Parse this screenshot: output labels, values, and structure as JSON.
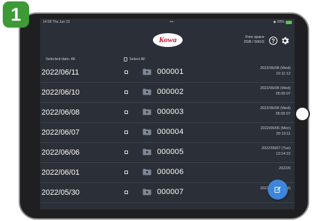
{
  "step_number": "1",
  "status_bar": {
    "time": "14:59  Thu Jun 23",
    "center": "•••",
    "battery": "83%"
  },
  "header": {
    "logo_text": "Kowa",
    "free_space_label": "Free space",
    "free_space_value": "2GB / 59GS"
  },
  "subheader": {
    "selected_date": "Selected date: All",
    "select_all": "Select All"
  },
  "rows": [
    {
      "date": "2022/06/11",
      "name": "000001",
      "mod_date": "2022/06/08 (Wed)",
      "mod_time": "10:11:12"
    },
    {
      "date": "2022/06/10",
      "name": "000002",
      "mod_date": "2022/06/08 (Wed)",
      "mod_time": "05:06:07"
    },
    {
      "date": "2022/06/08",
      "name": "000003",
      "mod_date": "2022/06/08 (Wed)",
      "mod_time": "05:06:07"
    },
    {
      "date": "2022/06/07",
      "name": "000004",
      "mod_date": "2022/06/06 (Mon)",
      "mod_time": "20:19:11"
    },
    {
      "date": "2022/06/06",
      "name": "000005",
      "mod_date": "2022/06/07 (Tue)",
      "mod_time": "13:14:15"
    },
    {
      "date": "2022/06/01",
      "name": "000006",
      "mod_date": "2022/0",
      "mod_time": ""
    },
    {
      "date": "2022/05/30",
      "name": "000007",
      "mod_date": "2022/06/08 (Wed)",
      "mod_time": ""
    }
  ],
  "icons": {
    "help": "question-mark",
    "settings": "gear",
    "folder": "folder",
    "fab": "edit"
  },
  "colors": {
    "screen_bg": "#2b2f37",
    "badge_green": "#3d9a36",
    "fab_blue": "#3d86d9",
    "logo_red": "#c8102e"
  }
}
